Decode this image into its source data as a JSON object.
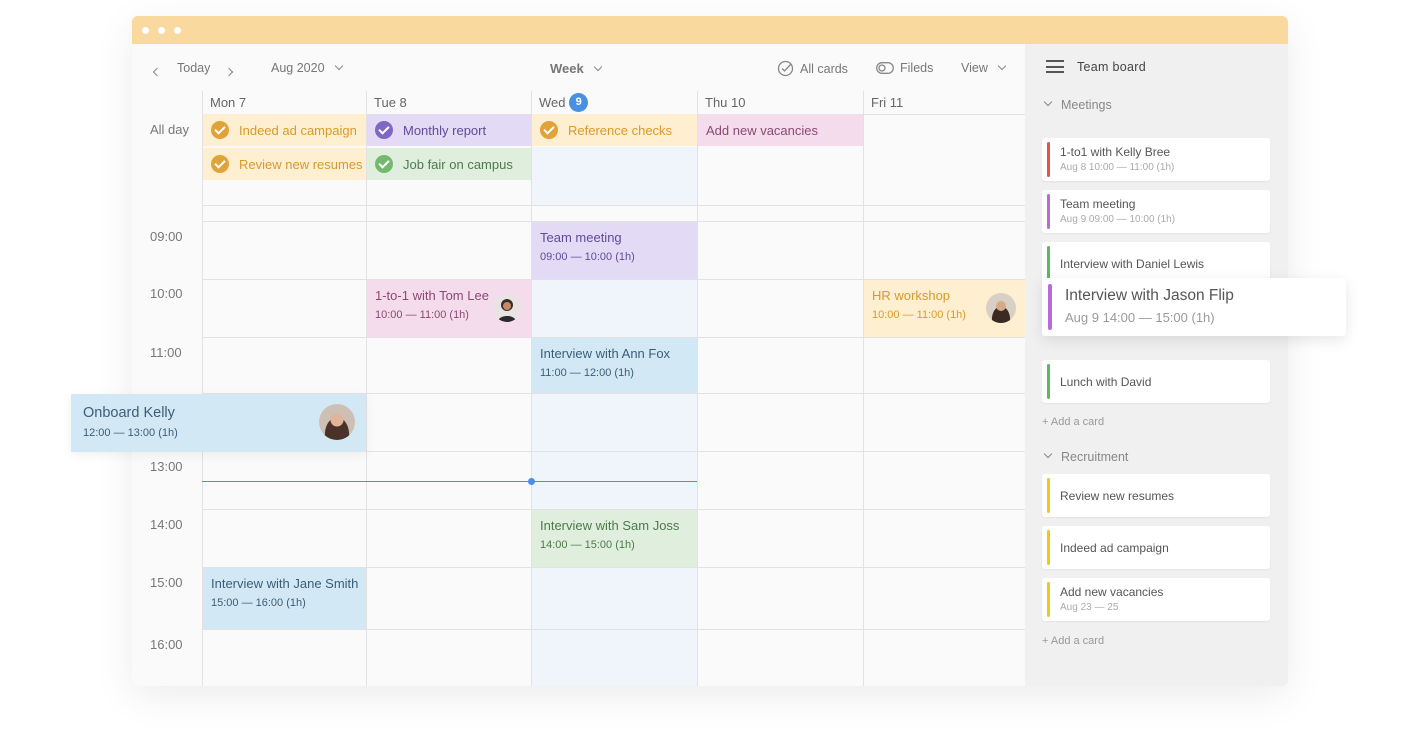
{
  "toolbar": {
    "today": "Today",
    "month": "Aug 2020",
    "view_mode": "Week",
    "all_cards": "All cards",
    "fields": "Fileds",
    "view": "View"
  },
  "days": [
    {
      "label": "Mon 7"
    },
    {
      "label": "Tue 8"
    },
    {
      "label": "Wed",
      "badge": "9"
    },
    {
      "label": "Thu 10"
    },
    {
      "label": "Fri 11"
    }
  ],
  "all_day_label": "All day",
  "all_day_events": [
    {
      "title": "Indeed ad campaign"
    },
    {
      "title": "Review new resumes"
    },
    {
      "title": "Monthly report"
    },
    {
      "title": "Job fair on campus"
    },
    {
      "title": "Reference checks"
    },
    {
      "title": "Add new vacancies"
    }
  ],
  "times": [
    "09:00",
    "10:00",
    "11:00",
    "13:00",
    "14:00",
    "15:00",
    "16:00"
  ],
  "events": [
    {
      "title": "Team meeting",
      "time": "09:00 — 10:00 (1h)"
    },
    {
      "title": "1-to-1 with Tom Lee",
      "time": "10:00 — 11:00 (1h)"
    },
    {
      "title": "HR workshop",
      "time": "10:00 — 11:00 (1h)"
    },
    {
      "title": "Interview with Ann Fox",
      "time": "11:00 — 12:00 (1h)"
    },
    {
      "title": "Onboard Kelly",
      "time": "12:00 — 13:00 (1h)"
    },
    {
      "title": "Interview with Sam Joss",
      "time": "14:00 — 15:00 (1h)"
    },
    {
      "title": "Interview with Jane Smith",
      "time": "15:00 — 16:00 (1h)"
    }
  ],
  "sidebar": {
    "title": "Team board",
    "sections": [
      {
        "name": "Meetings",
        "cards": [
          {
            "title": "1-to1 with Kelly Bree",
            "sub": "Aug 8 10:00 — 11:00 (1h)",
            "color": "#e5534b"
          },
          {
            "title": "Team meeting",
            "sub": "Aug 9 09:00 — 10:00 (1h)",
            "color": "#b86bd8"
          },
          {
            "title": "Interview with Daniel Lewis",
            "sub": "",
            "color": "#5cb85c"
          },
          {
            "title": "Interview with Jason Flip",
            "sub": "Aug 9 14:00 — 15:00 (1h)",
            "color": "#b86bd8"
          },
          {
            "title": "Lunch with David",
            "sub": "",
            "color": "#5cb85c"
          }
        ],
        "add": "+ Add a card"
      },
      {
        "name": "Recruitment",
        "cards": [
          {
            "title": "Review new resumes",
            "sub": "",
            "color": "#f2c811"
          },
          {
            "title": "Indeed ad campaign",
            "sub": "",
            "color": "#f2c811"
          },
          {
            "title": "Add new vacancies",
            "sub": "Aug 23 — 25",
            "color": "#f2c811"
          }
        ],
        "add": "+ Add a card"
      }
    ]
  },
  "colors": {
    "titlebar": "#fad99f",
    "orange_bg": "#fdefd0",
    "orange_text": "#d89a2c",
    "purple_bg": "#e3dbf5",
    "purple_text": "#5e4b99",
    "green_bg": "#dfeedd",
    "green_text": "#4d7b4b",
    "pink_bg": "#f4dcec",
    "blue_bg": "#d3e8f5",
    "blue_text": "#3b5d78",
    "accent_blue": "#4a90e2"
  }
}
